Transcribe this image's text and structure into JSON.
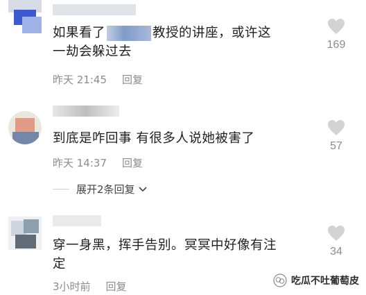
{
  "comments": [
    {
      "text_before": "如果看了",
      "text_after": "教授的讲座，或许这",
      "text_line2": "一劫会躲过去",
      "time": "昨天 21:45",
      "reply": "回复",
      "likes": "169"
    },
    {
      "text": "到底是咋回事 有很多人说她被害了",
      "time": "昨天 14:37",
      "reply": "回复",
      "likes": "57"
    },
    {
      "text": "穿一身黑，挥手告别。冥冥中好像有注",
      "text_line2": "定",
      "time": "3小时前",
      "reply": "回复",
      "likes": "34"
    }
  ],
  "expand_replies": "展开2条回复",
  "watermark": "吃瓜不吐葡萄皮",
  "icons": [
    "heart-icon",
    "chevron-down-icon",
    "wechat-logo-icon"
  ],
  "colors": {
    "text": "#1f1f1f",
    "meta": "#8c8c8c",
    "heart": "#d3d3d3"
  }
}
